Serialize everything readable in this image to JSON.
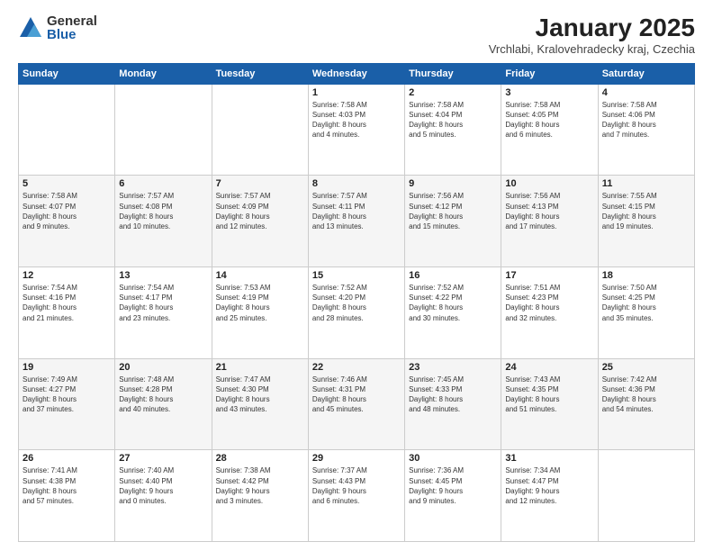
{
  "logo": {
    "general": "General",
    "blue": "Blue"
  },
  "title": "January 2025",
  "subtitle": "Vrchlabi, Kralovehradecky kraj, Czechia",
  "header_days": [
    "Sunday",
    "Monday",
    "Tuesday",
    "Wednesday",
    "Thursday",
    "Friday",
    "Saturday"
  ],
  "weeks": [
    [
      {
        "day": "",
        "info": ""
      },
      {
        "day": "",
        "info": ""
      },
      {
        "day": "",
        "info": ""
      },
      {
        "day": "1",
        "info": "Sunrise: 7:58 AM\nSunset: 4:03 PM\nDaylight: 8 hours\nand 4 minutes."
      },
      {
        "day": "2",
        "info": "Sunrise: 7:58 AM\nSunset: 4:04 PM\nDaylight: 8 hours\nand 5 minutes."
      },
      {
        "day": "3",
        "info": "Sunrise: 7:58 AM\nSunset: 4:05 PM\nDaylight: 8 hours\nand 6 minutes."
      },
      {
        "day": "4",
        "info": "Sunrise: 7:58 AM\nSunset: 4:06 PM\nDaylight: 8 hours\nand 7 minutes."
      }
    ],
    [
      {
        "day": "5",
        "info": "Sunrise: 7:58 AM\nSunset: 4:07 PM\nDaylight: 8 hours\nand 9 minutes."
      },
      {
        "day": "6",
        "info": "Sunrise: 7:57 AM\nSunset: 4:08 PM\nDaylight: 8 hours\nand 10 minutes."
      },
      {
        "day": "7",
        "info": "Sunrise: 7:57 AM\nSunset: 4:09 PM\nDaylight: 8 hours\nand 12 minutes."
      },
      {
        "day": "8",
        "info": "Sunrise: 7:57 AM\nSunset: 4:11 PM\nDaylight: 8 hours\nand 13 minutes."
      },
      {
        "day": "9",
        "info": "Sunrise: 7:56 AM\nSunset: 4:12 PM\nDaylight: 8 hours\nand 15 minutes."
      },
      {
        "day": "10",
        "info": "Sunrise: 7:56 AM\nSunset: 4:13 PM\nDaylight: 8 hours\nand 17 minutes."
      },
      {
        "day": "11",
        "info": "Sunrise: 7:55 AM\nSunset: 4:15 PM\nDaylight: 8 hours\nand 19 minutes."
      }
    ],
    [
      {
        "day": "12",
        "info": "Sunrise: 7:54 AM\nSunset: 4:16 PM\nDaylight: 8 hours\nand 21 minutes."
      },
      {
        "day": "13",
        "info": "Sunrise: 7:54 AM\nSunset: 4:17 PM\nDaylight: 8 hours\nand 23 minutes."
      },
      {
        "day": "14",
        "info": "Sunrise: 7:53 AM\nSunset: 4:19 PM\nDaylight: 8 hours\nand 25 minutes."
      },
      {
        "day": "15",
        "info": "Sunrise: 7:52 AM\nSunset: 4:20 PM\nDaylight: 8 hours\nand 28 minutes."
      },
      {
        "day": "16",
        "info": "Sunrise: 7:52 AM\nSunset: 4:22 PM\nDaylight: 8 hours\nand 30 minutes."
      },
      {
        "day": "17",
        "info": "Sunrise: 7:51 AM\nSunset: 4:23 PM\nDaylight: 8 hours\nand 32 minutes."
      },
      {
        "day": "18",
        "info": "Sunrise: 7:50 AM\nSunset: 4:25 PM\nDaylight: 8 hours\nand 35 minutes."
      }
    ],
    [
      {
        "day": "19",
        "info": "Sunrise: 7:49 AM\nSunset: 4:27 PM\nDaylight: 8 hours\nand 37 minutes."
      },
      {
        "day": "20",
        "info": "Sunrise: 7:48 AM\nSunset: 4:28 PM\nDaylight: 8 hours\nand 40 minutes."
      },
      {
        "day": "21",
        "info": "Sunrise: 7:47 AM\nSunset: 4:30 PM\nDaylight: 8 hours\nand 43 minutes."
      },
      {
        "day": "22",
        "info": "Sunrise: 7:46 AM\nSunset: 4:31 PM\nDaylight: 8 hours\nand 45 minutes."
      },
      {
        "day": "23",
        "info": "Sunrise: 7:45 AM\nSunset: 4:33 PM\nDaylight: 8 hours\nand 48 minutes."
      },
      {
        "day": "24",
        "info": "Sunrise: 7:43 AM\nSunset: 4:35 PM\nDaylight: 8 hours\nand 51 minutes."
      },
      {
        "day": "25",
        "info": "Sunrise: 7:42 AM\nSunset: 4:36 PM\nDaylight: 8 hours\nand 54 minutes."
      }
    ],
    [
      {
        "day": "26",
        "info": "Sunrise: 7:41 AM\nSunset: 4:38 PM\nDaylight: 8 hours\nand 57 minutes."
      },
      {
        "day": "27",
        "info": "Sunrise: 7:40 AM\nSunset: 4:40 PM\nDaylight: 9 hours\nand 0 minutes."
      },
      {
        "day": "28",
        "info": "Sunrise: 7:38 AM\nSunset: 4:42 PM\nDaylight: 9 hours\nand 3 minutes."
      },
      {
        "day": "29",
        "info": "Sunrise: 7:37 AM\nSunset: 4:43 PM\nDaylight: 9 hours\nand 6 minutes."
      },
      {
        "day": "30",
        "info": "Sunrise: 7:36 AM\nSunset: 4:45 PM\nDaylight: 9 hours\nand 9 minutes."
      },
      {
        "day": "31",
        "info": "Sunrise: 7:34 AM\nSunset: 4:47 PM\nDaylight: 9 hours\nand 12 minutes."
      },
      {
        "day": "",
        "info": ""
      }
    ]
  ]
}
